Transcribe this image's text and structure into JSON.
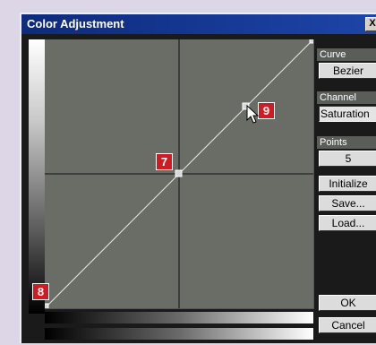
{
  "window": {
    "title": "Color Adjustment",
    "close_label": "X"
  },
  "curve": {
    "points": [
      [
        0,
        0
      ],
      [
        0.5,
        0.5
      ],
      [
        0.75,
        0.75
      ],
      [
        1,
        1
      ]
    ],
    "type_label": "Curve",
    "type_value": "Bezier"
  },
  "channel": {
    "label": "Channel",
    "value": "Saturation"
  },
  "points_section": {
    "label": "Points",
    "count": "5"
  },
  "buttons": {
    "initialize": "Initialize",
    "save": "Save...",
    "load": "Load...",
    "ok": "OK",
    "cancel": "Cancel"
  },
  "badges": {
    "center": "7",
    "bottom_left": "8",
    "upper_right": "9"
  },
  "colors": {
    "badge": "#d01b22",
    "titlebar": "#0e2b7c",
    "panel": "#6a6d66"
  }
}
